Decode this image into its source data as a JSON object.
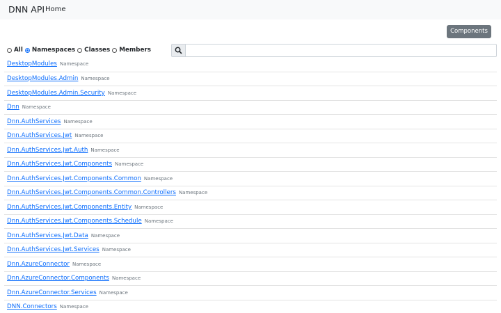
{
  "navbar": {
    "brand": "DNN API",
    "home": "Home"
  },
  "toolbar": {
    "components_label": "Components"
  },
  "filters": [
    {
      "label": "All",
      "checked": false
    },
    {
      "label": "Namespaces",
      "checked": true
    },
    {
      "label": "Classes",
      "checked": false
    },
    {
      "label": "Members",
      "checked": false
    }
  ],
  "search": {
    "placeholder": "",
    "value": "",
    "icon": "search-icon"
  },
  "colors": {
    "link": "#0d6efd",
    "button": "#6c757d",
    "navbar": "#f8f9fa"
  },
  "namespaces": [
    {
      "name": "DesktopModules",
      "kind": "Namespace"
    },
    {
      "name": "DesktopModules.Admin",
      "kind": "Namespace"
    },
    {
      "name": "DesktopModules.Admin.Security",
      "kind": "Namespace"
    },
    {
      "name": "Dnn",
      "kind": "Namespace"
    },
    {
      "name": "Dnn.AuthServices",
      "kind": "Namespace"
    },
    {
      "name": "Dnn.AuthServices.Jwt",
      "kind": "Namespace"
    },
    {
      "name": "Dnn.AuthServices.Jwt.Auth",
      "kind": "Namespace"
    },
    {
      "name": "Dnn.AuthServices.Jwt.Components",
      "kind": "Namespace"
    },
    {
      "name": "Dnn.AuthServices.Jwt.Components.Common",
      "kind": "Namespace"
    },
    {
      "name": "Dnn.AuthServices.Jwt.Components.Common.Controllers",
      "kind": "Namespace"
    },
    {
      "name": "Dnn.AuthServices.Jwt.Components.Entity",
      "kind": "Namespace"
    },
    {
      "name": "Dnn.AuthServices.Jwt.Components.Schedule",
      "kind": "Namespace"
    },
    {
      "name": "Dnn.AuthServices.Jwt.Data",
      "kind": "Namespace"
    },
    {
      "name": "Dnn.AuthServices.Jwt.Services",
      "kind": "Namespace"
    },
    {
      "name": "Dnn.AzureConnector",
      "kind": "Namespace"
    },
    {
      "name": "Dnn.AzureConnector.Components",
      "kind": "Namespace"
    },
    {
      "name": "Dnn.AzureConnector.Services",
      "kind": "Namespace"
    },
    {
      "name": "DNN.Connectors",
      "kind": "Namespace"
    }
  ]
}
